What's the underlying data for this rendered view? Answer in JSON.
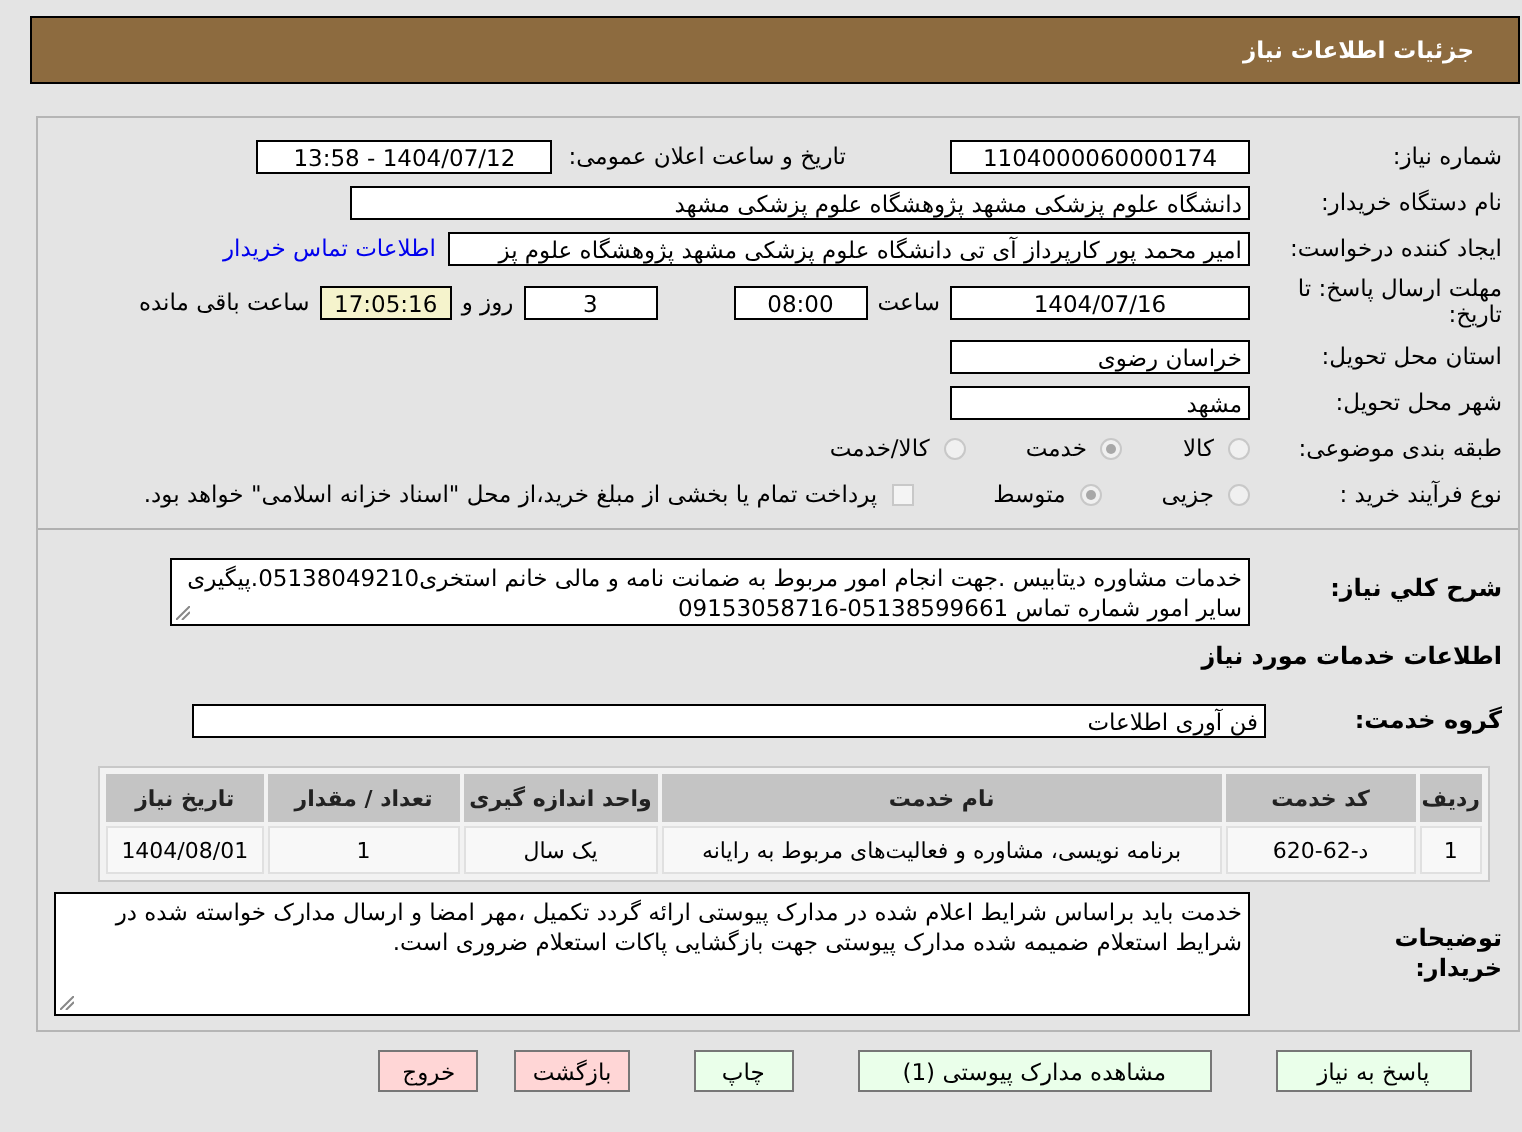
{
  "header": {
    "title": "جزئیات اطلاعات نیاز"
  },
  "need_number": {
    "label": "شماره نیاز:",
    "value": "1104000060000174"
  },
  "announce": {
    "label": "تاریخ و ساعت اعلان عمومی:",
    "value": "1404/07/12 - 13:58"
  },
  "buyer_org": {
    "label": "نام دستگاه خریدار:",
    "value": "دانشگاه علوم پزشکی مشهد   پژوهشگاه علوم پزشکی مشهد"
  },
  "creator": {
    "label": "ایجاد کننده درخواست:",
    "value": "امیر محمد پور کارپرداز آی تی دانشگاه علوم پزشکی مشهد   پژوهشگاه علوم پز",
    "link": "اطلاعات تماس خریدار"
  },
  "deadline": {
    "label": "مهلت ارسال پاسخ: تا تاریخ:",
    "date": "1404/07/16",
    "time_label": "ساعت",
    "time": "08:00",
    "days": "3",
    "days_label": "روز و",
    "remaining": "17:05:16",
    "remaining_label": "ساعت باقی مانده"
  },
  "province": {
    "label": "استان محل تحویل:",
    "value": "خراسان رضوی"
  },
  "city": {
    "label": "شهر محل تحویل:",
    "value": "مشهد"
  },
  "category": {
    "label": "طبقه بندی موضوعی:",
    "options": [
      {
        "label": "کالا",
        "selected": false
      },
      {
        "label": "خدمت",
        "selected": true
      },
      {
        "label": "کالا/خدمت",
        "selected": false
      }
    ]
  },
  "process": {
    "label": "نوع فرآیند خرید :",
    "options": [
      {
        "label": "جزیی",
        "selected": false
      },
      {
        "label": "متوسط",
        "selected": true
      }
    ],
    "payment": {
      "label": "پرداخت تمام یا بخشی از مبلغ خرید،از محل \"اسناد خزانه اسلامی\" خواهد بود.",
      "checked": false
    }
  },
  "description": {
    "label": "شرح کلي نياز:",
    "value": "خدمات مشاوره دیتابیس .جهت انجام امور مربوط به ضمانت نامه و مالی خانم استخری05138049210.پیگیری سایر امور شماره تماس 05138599661-09153058716"
  },
  "section_title": "اطلاعات خدمات مورد نیاز",
  "service_group": {
    "label": "گروه خدمت:",
    "value": "فن آوری اطلاعات"
  },
  "table": {
    "columns": [
      "ردیف",
      "کد خدمت",
      "نام خدمت",
      "واحد اندازه گیری",
      "تعداد / مقدار",
      "تاریخ نیاز"
    ],
    "rows": [
      [
        "1",
        "د-62-620",
        "برنامه نویسی، مشاوره و فعالیت‌های مربوط به رایانه",
        "یک سال",
        "1",
        "1404/08/01"
      ]
    ]
  },
  "buyer_notes": {
    "label": "توضیحات خریدار:",
    "value": "خدمت باید براساس شرایط اعلام شده در مدارک پیوستی ارائه گردد تکمیل ،مهر امضا و ارسال مدارک خواسته شده در شرایط استعلام ضمیمه شده مدارک پیوستی جهت بازگشایی پاکات استعلام ضروری است."
  },
  "buttons": [
    {
      "label": "پاسخ به نیاز",
      "kind": "normal"
    },
    {
      "label": "مشاهده مدارک پیوستی (1)",
      "kind": "normal"
    },
    {
      "label": "چاپ",
      "kind": "normal"
    },
    {
      "label": "بازگشت",
      "kind": "danger"
    },
    {
      "label": "خروج",
      "kind": "danger"
    }
  ]
}
